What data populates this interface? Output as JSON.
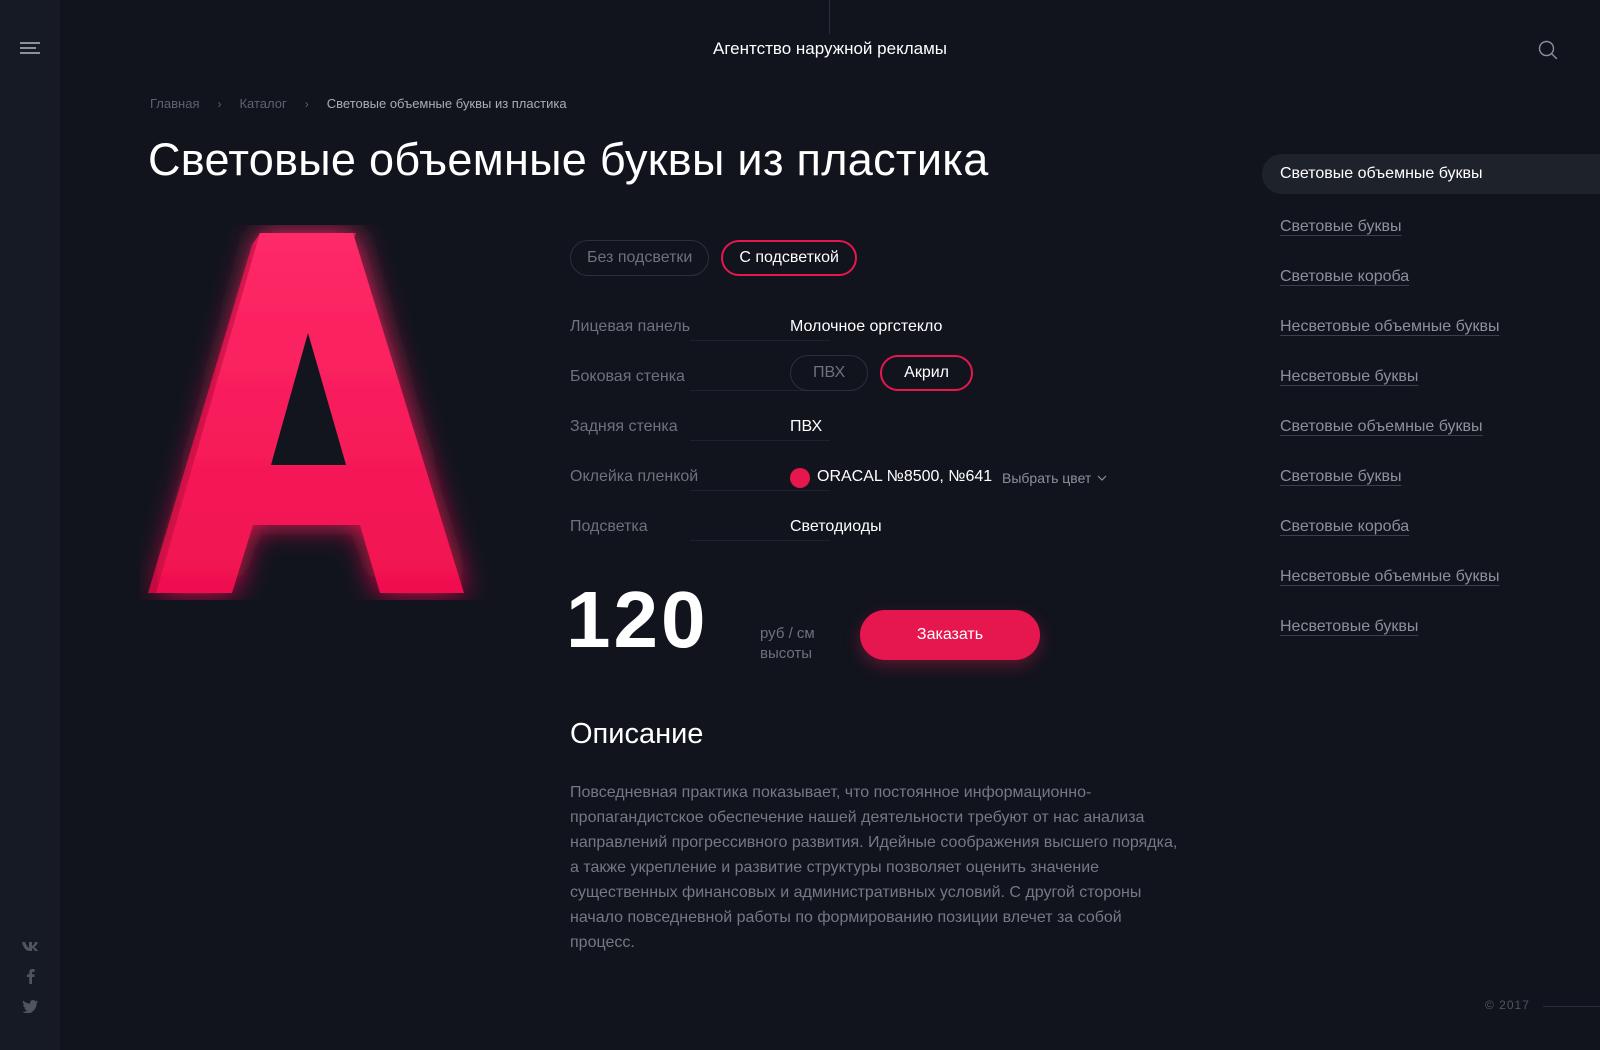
{
  "header": {
    "site_title": "Агентство наружной рекламы"
  },
  "breadcrumb": {
    "items": [
      "Главная",
      "Каталог"
    ],
    "current": "Световые объемные буквы из пластика"
  },
  "page_title": "Световые объемные буквы из пластика",
  "visual": {
    "letter": "A",
    "letter_color": "#ff1a5e"
  },
  "lighting_options": {
    "options": [
      "Без подсветки",
      "С подсветкой"
    ],
    "selected": "С подсветкой"
  },
  "specs": {
    "face_panel": {
      "label": "Лицевая панель",
      "value": "Молочное оргстекло"
    },
    "side_wall": {
      "label": "Боковая стенка",
      "options": [
        "ПВХ",
        "Акрил"
      ],
      "selected": "Акрил"
    },
    "back_wall": {
      "label": "Задняя стенка",
      "value": "ПВХ"
    },
    "film": {
      "label": "Оклейка пленкой",
      "value": "ORACAL №8500, №641",
      "color": "#e6164f",
      "choose_label": "Выбрать цвет"
    },
    "lighting": {
      "label": "Подсветка",
      "value": "Светодиоды"
    }
  },
  "price": {
    "value": "120",
    "unit_line1": "руб / см",
    "unit_line2": "высоты"
  },
  "order_button": "Заказать",
  "description": {
    "title": "Описание",
    "text": "Повседневная практика показывает, что постоянное информационно-пропагандистское обеспечение нашей деятельности требуют от нас анализа направлений прогрессивного развития. Идейные соображения высшего порядка, а также укрепление и развитие структуры позволяет оценить значение существенных финансовых и административных условий. С другой стороны начало повседневной работы по формированию позиции влечет за собой процесс."
  },
  "sidebar": {
    "items": [
      "Световые объемные буквы",
      "Световые буквы",
      "Световые короба",
      "Несветовые объемные буквы",
      "Несветовые буквы",
      "Световые объемные буквы",
      "Световые буквы",
      "Световые короба",
      "Несветовые объемные буквы",
      "Несветовые буквы"
    ],
    "active_index": 0
  },
  "social": [
    "vk-icon",
    "facebook-icon",
    "twitter-icon"
  ],
  "footer": {
    "copyright": "© 2017"
  },
  "colors": {
    "accent": "#e6164f",
    "background": "#11141d",
    "muted_text": "#6d727c"
  }
}
